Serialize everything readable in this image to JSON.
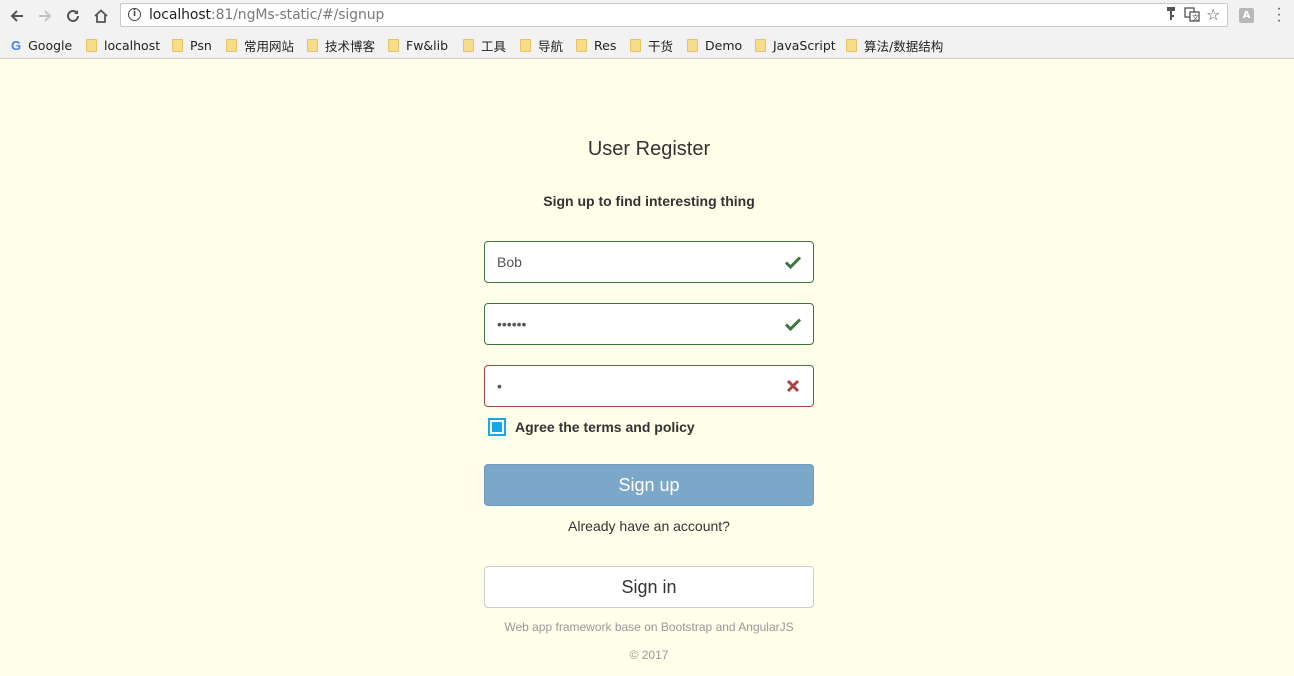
{
  "browser": {
    "url_host": "localhost",
    "url_rest": ":81/ngMs-static/#/signup",
    "extension_label": "A",
    "bookmarks": [
      "Google",
      "localhost",
      "Psn",
      "常用网站",
      "技术博客",
      "Fw&lib",
      "工具",
      "导航",
      "Res",
      "干货",
      "Demo",
      "JavaScript",
      "算法/数据结构"
    ]
  },
  "page": {
    "title": "User Register",
    "subtitle": "Sign up to find interesting thing",
    "username_value": "Bob",
    "password_value": "••••••",
    "confirm_value": "•",
    "agree_label": "Agree the terms and policy",
    "signup_label": "Sign up",
    "already_text": "Already have an account?",
    "signin_label": "Sign in",
    "footer_text": "Web app framework base on Bootstrap and AngularJS",
    "copyright": "© 2017"
  },
  "colors": {
    "page_bg": "#fefee9",
    "success": "#3c763d",
    "error": "#a94442",
    "primary_button": "#7ba7c9",
    "checkbox": "#16a9e6"
  }
}
